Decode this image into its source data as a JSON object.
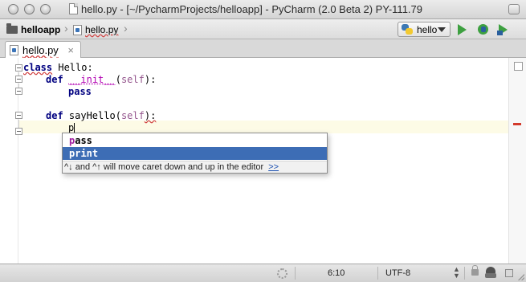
{
  "window": {
    "title": "hello.py - [~/PycharmProjects/helloapp] - PyCharm (2.0 Beta 2) PY-111.79"
  },
  "navbar": {
    "breadcrumbs": [
      {
        "label": "helloapp",
        "icon": "folder-icon"
      },
      {
        "label": "hello.py",
        "icon": "python-file-icon"
      }
    ],
    "run_config": "hello",
    "buttons": [
      "run-icon",
      "debug-icon",
      "run-with-coverage-icon"
    ]
  },
  "tabs": [
    {
      "label": "hello.py",
      "icon": "python-file-icon",
      "active": true
    }
  ],
  "editor": {
    "lines": {
      "l1": {
        "kw": "class",
        "rest": " Hello:"
      },
      "l2": {
        "kw": "def",
        "name": "__init__",
        "open": "(",
        "self": "self",
        "close": "):"
      },
      "l3": {
        "kw": "pass"
      },
      "l5": {
        "kw": "def",
        "name": " sayHello(",
        "self": "self",
        "close": "):"
      },
      "l6": {
        "typed": "p"
      }
    },
    "caret_line_color": "#fdfbe6",
    "error_stripe_color": "#d33a2c"
  },
  "completion": {
    "items": [
      {
        "match": "p",
        "rest": "ass",
        "selected": false
      },
      {
        "label": "print",
        "selected": true
      }
    ],
    "hint": "^↓ and ^↑ will move caret down and up in the editor",
    "hint_link": ">>",
    "selection_color": "#3d6db5"
  },
  "statusbar": {
    "position": "6:10",
    "encoding": "UTF-8"
  }
}
